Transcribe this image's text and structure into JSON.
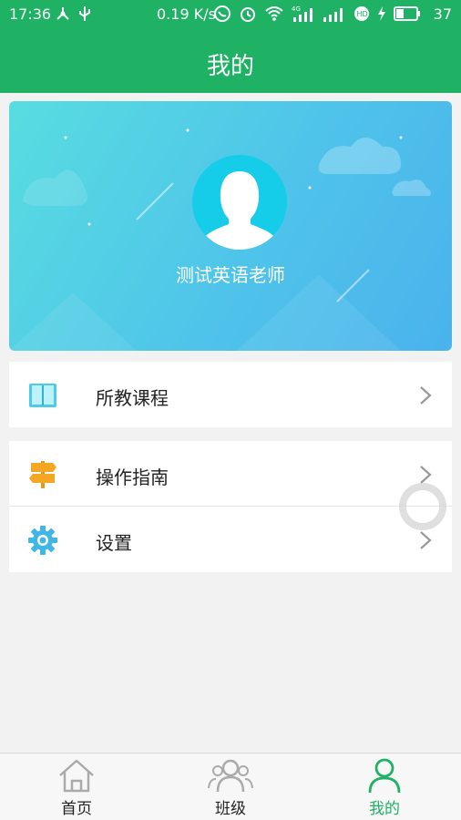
{
  "status_bar": {
    "time": "17:36",
    "net_speed": "0.19 K/s",
    "network": "4G",
    "battery": "37"
  },
  "header": {
    "title": "我的"
  },
  "profile": {
    "name": "测试英语老师",
    "avatar_icon": "female-avatar-icon"
  },
  "menu_groups": [
    {
      "items": [
        {
          "label": "所教课程",
          "icon": "book-icon"
        }
      ]
    },
    {
      "items": [
        {
          "label": "操作指南",
          "icon": "signpost-icon"
        },
        {
          "label": "设置",
          "icon": "settings-gear-icon"
        }
      ]
    }
  ],
  "tabbar": {
    "items": [
      {
        "label": "首页",
        "icon": "home-icon",
        "active": false
      },
      {
        "label": "班级",
        "icon": "class-group-icon",
        "active": false
      },
      {
        "label": "我的",
        "icon": "profile-icon",
        "active": true
      }
    ]
  },
  "colors": {
    "brand_green": "#1fb264",
    "card_gradient_start": "#58dde0",
    "card_gradient_end": "#4ab2ec"
  }
}
